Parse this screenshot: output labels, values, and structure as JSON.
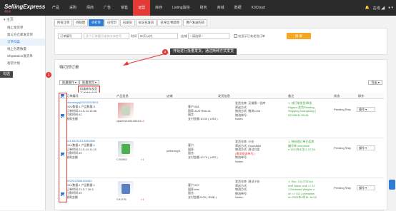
{
  "brand": {
    "name": "SellingExpress",
    "sub": "易售易"
  },
  "nav": [
    "产品",
    "采购",
    "招商",
    "广告",
    "销售",
    "运营",
    "库存",
    "Listing监控",
    "财务",
    "商城",
    "数据",
    "K3Cloud"
  ],
  "nav_right": {
    "user": "在线 ◢",
    "avatar_label": "● ▾"
  },
  "sidebar": {
    "head": "主页",
    "items": [
      "线上发货单",
      "第三方仓库发货单",
      "订单归类",
      "线上包裹数量",
      "Shipstation发货单",
      "发货计划"
    ]
  },
  "tabs": [
    "所有订单",
    "待处理",
    "待打单",
    "已打印",
    "已发货",
    "标记已发货",
    "已导出 物流单",
    "用户发送的货"
  ],
  "filter": {
    "sel1": "订单编号",
    "input1": "多个订单编号或有文本定号",
    "sel2": "时间",
    "sel3": "60天以内",
    "sel4": "店铺",
    "sel5": "--请选择--",
    "check_label": "仅显示已有发货订单",
    "search": "搜 索"
  },
  "list": {
    "title": "待打印订单",
    "batch_btn": "批量操作 ▾",
    "print_btn": "批量发货 ▾",
    "export_btn": "导出 ▾",
    "dropdown": [
      "扣减库存发货",
      "不减库存发货"
    ],
    "callout_top": "开始进行批量发货，通过两种方式发货",
    "callout_left": "勾选",
    "badge1": "2",
    "badge2": "1",
    "headers": [
      "订单编号",
      "产品信息",
      "店铺",
      "发货信息",
      "备注",
      "状态",
      "操作"
    ]
  },
  "rows": [
    {
      "id": "chamengxji20210515001",
      "l1": "SKU数量:1 产品数量:3",
      "l2": "订单时间:21-5-14 15:56",
      "l3": "付款时间:42",
      "l4": "收款金额",
      "sku": "cjsb202105140013",
      "qty": "×3",
      "shop": "",
      "addr": [
        "客户:081",
        "国家:AUSTRALIA",
        "留言:",
        "支付金额:10.00 ( USD )"
      ],
      "ship": [
        "发货仓库:  无锡第一仓库",
        "寄送方式:",
        "物流方式:  物流1234",
        "物流单号:",
        "Notes:"
      ],
      "note": [
        "1. 待打单发货/联系",
        "Hipped-发货Pending",
        "Shipping   huangsong [",
        "02105611:59:34"
      ],
      "status": "Pending Ship",
      "op": "操作"
    },
    {
      "id": "113-5423113-5591866",
      "l1": "SKU数量:1 产品数量:1",
      "l2": "订单时间:21-5-14 11:15",
      "l3": "付款时间:49",
      "l4": "收款金额",
      "sku": "CJG062",
      "qty": "×1",
      "shop": "petezengS",
      "addr": [
        "客户:",
        "国家:",
        "留言:",
        "支付金额:10.79 ( USD )"
      ],
      "ship": [
        "发货仓库:  小仓",
        "寄送方式:  Expedited",
        "物流方式:  测试方案",
        "(需发物流单号)",
        "物流单号:",
        "Notes:"
      ],
      "note": [
        "1. 待处理订单已扣库",
        "编号单   chenhiwe",
        "n   2021年4月11 07:36"
      ],
      "status": "Pending Ship",
      "op": "操作"
    },
    {
      "id": "3020210606154440",
      "l1": "SKU数量:1 产品数量:1",
      "l2": "订单时间:21-5-7 16:3",
      "l3": "付款时间:49",
      "l4": "收款金额",
      "sku": "CA-076",
      "qty": "×1",
      "shop": "",
      "addr": [
        "客户:007",
        "国家:test",
        "留言:",
        "支付金额:5.00 ( RMB )"
      ],
      "ship": [
        "发货仓库:  测试小仓",
        "寄送方式:",
        "物流方式:",
        "物流单号:",
        "Notes:"
      ],
      "note": [
        "1. Sku: CA-076Cecl",
        "eref Value: null => 11",
        "1 Declared Weight: n",
        "ull => 111 | chenshiw",
        "en   2021年4月11 16:02"
      ],
      "status": "Pending Ship",
      "op": "操作"
    }
  ],
  "colors": {
    "accent": "#2f7bd6",
    "nav_active": "#e53935",
    "topbar": "#2b2b2b",
    "search": "#f5a623"
  }
}
